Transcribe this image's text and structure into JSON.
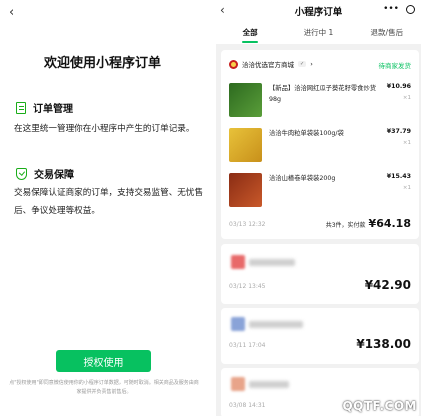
{
  "left": {
    "back": "‹",
    "welcome": "欢迎使用小程序订单",
    "sections": [
      {
        "title": "订单管理",
        "icon": "document-icon",
        "body": "在这里统一管理你在小程序中产生的订单记录。"
      },
      {
        "title": "交易保障",
        "icon": "shield-check-icon",
        "body": "交易保障认证商家的订单，支持交易监管、无忧售后、争议处理等权益。"
      }
    ],
    "auth_button": "授权使用",
    "footnote": "点\"授权使用\"即同意微信使用你的小程序订单数据，可随时取消。相关商品及服务由商家提供并负责售前售后。"
  },
  "right": {
    "back": "‹",
    "title": "小程序订单",
    "capsule_more": "•••",
    "tabs": [
      {
        "label": "全部",
        "active": true
      },
      {
        "label": "进行中 1",
        "active": false
      },
      {
        "label": "退款/售后",
        "active": false
      }
    ],
    "order1": {
      "shop": "洽洽优选官方商城",
      "shop_badge": "✓",
      "shop_arrow": "›",
      "status": "待商家发货",
      "items": [
        {
          "name": "【新品】洽洽网红瓜子葵花籽零食炒货98g",
          "price": "¥10.96",
          "qty": "×1",
          "thumb_color": "#3e7d2f"
        },
        {
          "name": "洽洽牛肉粒单袋装100g/袋",
          "price": "¥37.79",
          "qty": "×1",
          "thumb_color": "#e0b12a"
        },
        {
          "name": "洽洽山楂卷单袋装200g",
          "price": "¥15.43",
          "qty": "×1",
          "thumb_color": "#b0431f"
        }
      ],
      "date": "03/13 12:32",
      "total_label": "共3件，实付款",
      "total": "¥64.18"
    },
    "order2": {
      "date": "03/12 13:45",
      "total": "¥42.90",
      "logo_color": "#e86a6a"
    },
    "order3": {
      "date": "03/11 17:04",
      "total": "¥138.00",
      "logo_color": "#8aa3d8"
    },
    "order4": {
      "date": "03/08 14:31",
      "logo_color": "#e8a48a"
    },
    "watermark": "QQTF.COM"
  },
  "colors": {
    "accent": "#07c160",
    "background": "#f1f1f1"
  }
}
